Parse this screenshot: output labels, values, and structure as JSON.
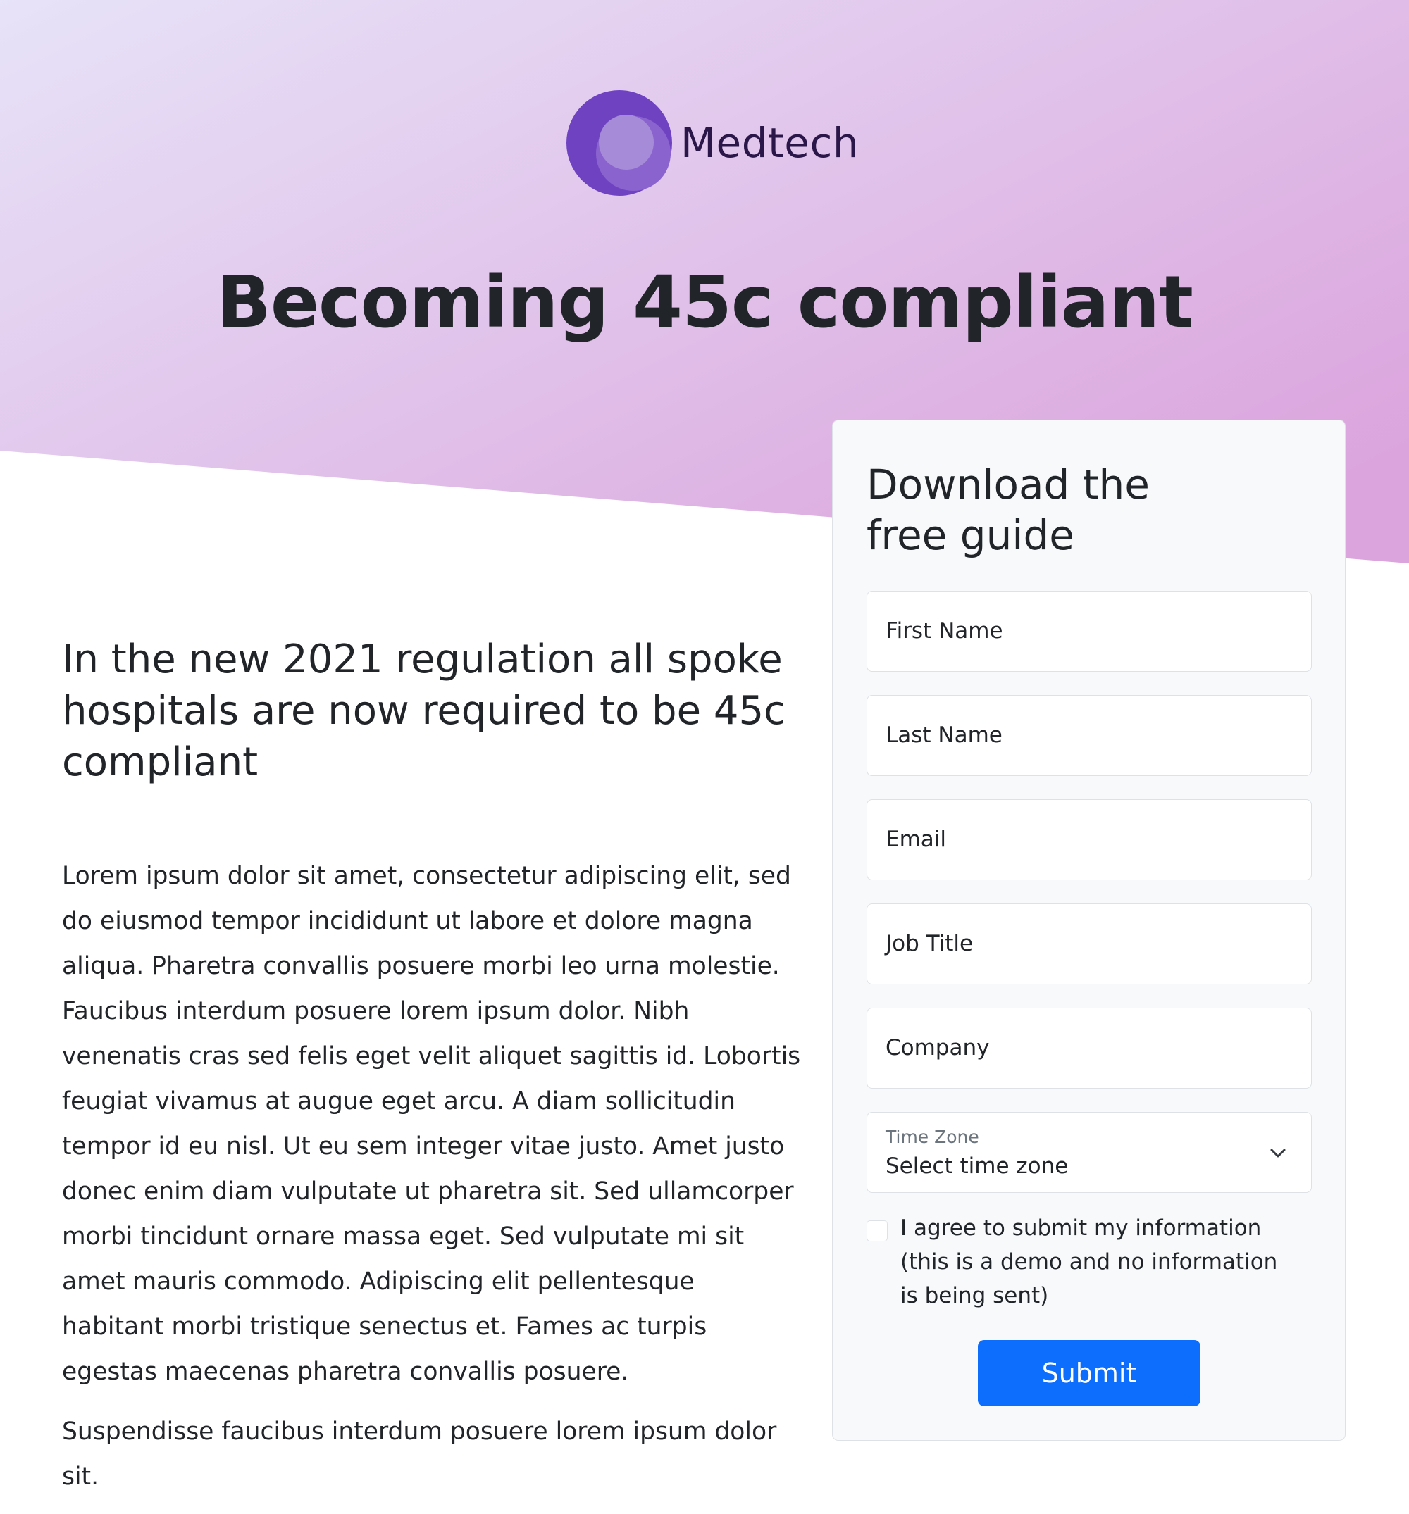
{
  "brand": {
    "name": "Medtech",
    "colors": {
      "primary_purple": "#6f42c1",
      "gradient_start": "#e7e3f8",
      "gradient_end": "#dba4dd",
      "submit_blue": "#0d6efd"
    }
  },
  "hero": {
    "title": "Becoming 45c compliant"
  },
  "content": {
    "heading": "In the new 2021 regulation all spoke hospitals are now required to be 45c compliant",
    "paragraphs": [
      "Lorem ipsum dolor sit amet, consectetur adipiscing elit, sed do eiusmod tempor incididunt ut labore et dolore magna aliqua. Pharetra convallis posuere morbi leo urna molestie. Faucibus interdum posuere lorem ipsum dolor. Nibh venenatis cras sed felis eget velit aliquet sagittis id. Lobortis feugiat vivamus at augue eget arcu. A diam sollicitudin tempor id eu nisl. Ut eu sem integer vitae justo. Amet justo donec enim diam vulputate ut pharetra sit. Sed ullamcorper morbi tincidunt ornare massa eget. Sed vulputate mi sit amet mauris commodo. Adipiscing elit pellentesque habitant morbi tristique senectus et. Fames ac turpis egestas maecenas pharetra convallis posuere.",
      "Suspendisse faucibus interdum posuere lorem ipsum dolor sit."
    ]
  },
  "form": {
    "heading": "Download the free guide",
    "fields": {
      "first_name": {
        "placeholder": "First Name",
        "value": ""
      },
      "last_name": {
        "placeholder": "Last Name",
        "value": ""
      },
      "email": {
        "placeholder": "Email",
        "value": ""
      },
      "job_title": {
        "placeholder": "Job Title",
        "value": ""
      },
      "company": {
        "placeholder": "Company",
        "value": ""
      }
    },
    "time_zone": {
      "label": "Time Zone",
      "selected": "Select time zone"
    },
    "consent": {
      "label": "I agree to submit my information (this is a demo and no information is being sent)",
      "checked": false
    },
    "submit_label": "Submit"
  },
  "icons": {
    "logo": "medtech-logo-icon",
    "select_arrow": "chevron-down-icon"
  }
}
